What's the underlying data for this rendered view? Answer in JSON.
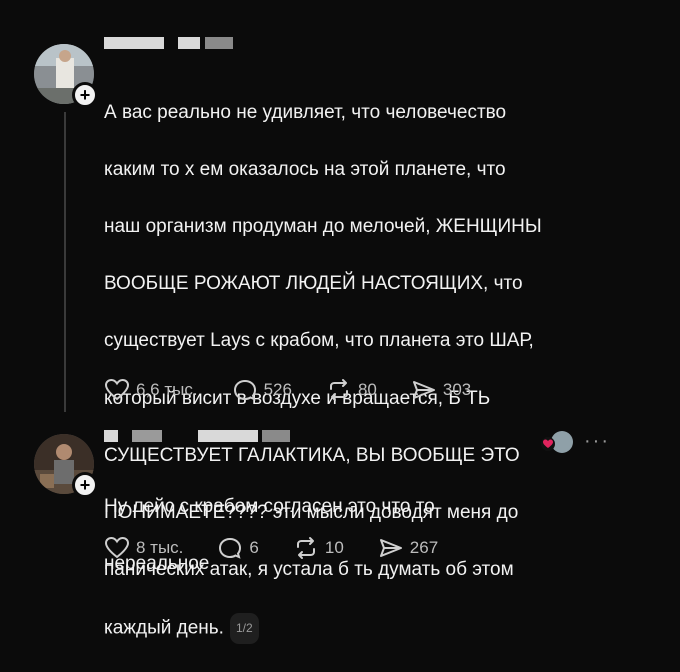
{
  "post1": {
    "lines": [
      "А вас реально не удивляет, что человечество",
      "каким то х   ем оказалось на этой планете, что",
      "наш организм продуман до мелочей, ЖЕНЩИНЫ",
      "ВООБЩЕ РОЖАЮТ ЛЮДЕЙ НАСТОЯЩИХ, что",
      "существует Lays с крабом, что планета это ШАР,",
      "который висит в воздухе и вращается, Б      ТЬ",
      "СУЩЕСТВУЕТ ГАЛАКТИКА, ВЫ ВООБЩЕ ЭТО",
      "ПОНИМАЕТЕ???? эти мысли доводят меня до",
      "панических атак, я устала б     ть думать об этом",
      "каждый день."
    ],
    "page_badge": "1/2",
    "likes": "6,6 тыс.",
    "replies": "526",
    "reposts": "80",
    "shares": "303"
  },
  "post2": {
    "lines": [
      "Ну лейс с крабом согласен это что то",
      "нереальное"
    ],
    "likes": "8 тыс.",
    "replies": "6",
    "reposts": "10",
    "shares": "267",
    "more": "···"
  },
  "icons": {
    "like": "heart-icon",
    "reply": "comment-icon",
    "repost": "repost-icon",
    "share": "send-icon",
    "follow": "plus-icon"
  },
  "colors": {
    "background": "#0b0b0b",
    "text": "#f2f2f2",
    "muted": "#bdbdbd"
  }
}
